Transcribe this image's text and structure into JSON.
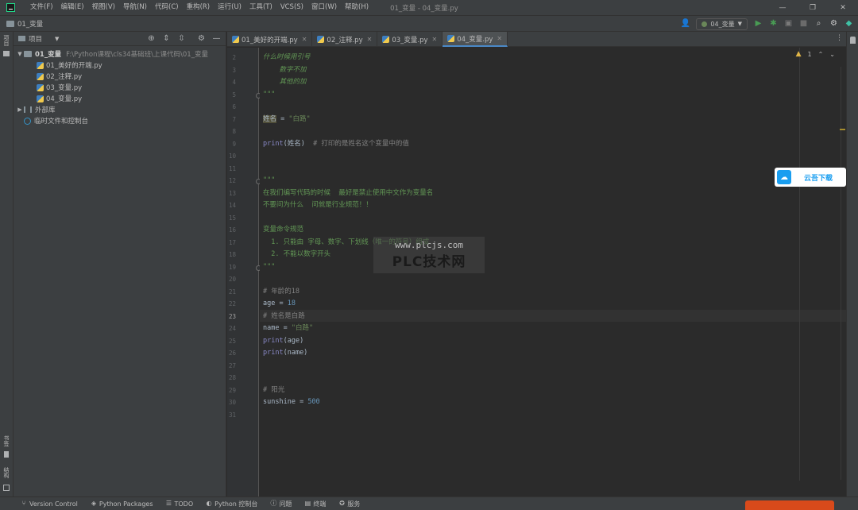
{
  "menu": {
    "items": [
      "文件(F)",
      "编辑(E)",
      "视图(V)",
      "导航(N)",
      "代码(C)",
      "重构(R)",
      "运行(U)",
      "工具(T)",
      "VCS(S)",
      "窗口(W)",
      "帮助(H)"
    ],
    "window_title": "01_变量 - 04_变量.py"
  },
  "navbar": {
    "breadcrumb": "01_变量",
    "run_config": "04_变量"
  },
  "left_strip": {
    "top_label": "项目",
    "bottom_labels": [
      "书签",
      "结构"
    ]
  },
  "project": {
    "title": "项目",
    "root": {
      "name": "01_变量",
      "path": "F:\\Python课程\\cls34基础班\\上课代码\\01_变量"
    },
    "files": [
      "01_美好的开端.py",
      "02_注释.py",
      "03_变量.py",
      "04_变量.py"
    ],
    "external_libs": "外部库",
    "scratches": "临时文件和控制台"
  },
  "tabs": [
    {
      "label": "01_美好的开端.py",
      "active": false
    },
    {
      "label": "02_注释.py",
      "active": false
    },
    {
      "label": "03_变量.py",
      "active": false
    },
    {
      "label": "04_变量.py",
      "active": true
    }
  ],
  "editor": {
    "warning_count": "1",
    "current_line": 23,
    "lines": [
      {
        "n": "2",
        "text": "什么时候用引号"
      },
      {
        "n": "3",
        "text": "    数字不加"
      },
      {
        "n": "4",
        "text": "    其他的加"
      },
      {
        "n": "5",
        "text": "\"\"\""
      },
      {
        "n": "6",
        "text": ""
      },
      {
        "n": "7",
        "name": "姓名",
        "rest_a": " = ",
        "str": "\"白路\""
      },
      {
        "n": "8",
        "text": ""
      },
      {
        "n": "9",
        "fn": "print",
        "arg": "(姓名)",
        "cmt": "  # 打印的是姓名这个变量中的值"
      },
      {
        "n": "10",
        "text": ""
      },
      {
        "n": "11",
        "text": ""
      },
      {
        "n": "12",
        "text": "\"\"\""
      },
      {
        "n": "13",
        "text": "在我们编写代码的时候  最好是禁止使用中文作为变量名"
      },
      {
        "n": "14",
        "text": "不要问为什么  问就是行业规范！！"
      },
      {
        "n": "15",
        "text": ""
      },
      {
        "n": "16",
        "text": "变量命令规范"
      },
      {
        "n": "17",
        "text": "  1. 只能由 字母、数字、下划线（唯一的符号）组成"
      },
      {
        "n": "18",
        "text": "  2. 不能以数字开头"
      },
      {
        "n": "19",
        "text": "\"\"\""
      },
      {
        "n": "20",
        "text": ""
      },
      {
        "n": "21",
        "text": "# 年龄的18"
      },
      {
        "n": "22",
        "id": "age",
        "op": " = ",
        "num": "18"
      },
      {
        "n": "23",
        "text": "# 姓名是白路"
      },
      {
        "n": "24",
        "id": "name",
        "op": " = ",
        "str": "\"白路\""
      },
      {
        "n": "25",
        "fn": "print",
        "arg": "(age)"
      },
      {
        "n": "26",
        "fn": "print",
        "arg": "(name)"
      },
      {
        "n": "27",
        "text": ""
      },
      {
        "n": "28",
        "text": ""
      },
      {
        "n": "29",
        "text": "# 阳光"
      },
      {
        "n": "30",
        "id": "sunshine",
        "op": " = ",
        "num": "500"
      },
      {
        "n": "31",
        "text": ""
      }
    ]
  },
  "overlay": {
    "download_badge": "云吾下载",
    "watermark_url": "www.plcjs.com",
    "watermark_title": "PLC技术网"
  },
  "statusbar": {
    "items": [
      "Version Control",
      "Python Packages",
      "TODO",
      "Python 控制台",
      "问题",
      "终端",
      "服务"
    ]
  },
  "colors": {
    "accent": "#4a88c7",
    "docstring": "#629755",
    "string": "#6a8759",
    "number": "#6897bb",
    "comment": "#808080"
  }
}
